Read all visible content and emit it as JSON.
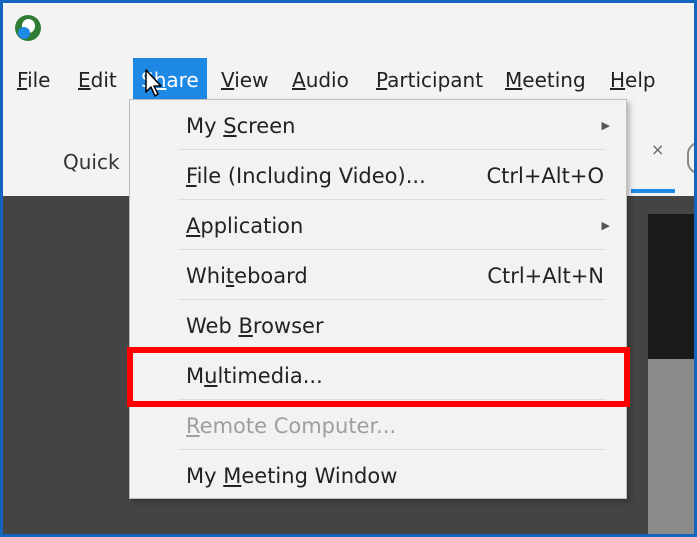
{
  "menubar": {
    "items": [
      {
        "label": "File",
        "u": "F",
        "rest": "ile"
      },
      {
        "label": "Edit",
        "u": "E",
        "rest": "dit"
      },
      {
        "label": "Share",
        "pre": "S",
        "u": "h",
        "rest": "are"
      },
      {
        "label": "View",
        "u": "V",
        "rest": "iew"
      },
      {
        "label": "Audio",
        "u": "A",
        "rest": "udio"
      },
      {
        "label": "Participant",
        "u": "P",
        "rest": "articipant"
      },
      {
        "label": "Meeting",
        "u": "M",
        "rest": "eeting"
      },
      {
        "label": "Help",
        "u": "H",
        "rest": "elp"
      }
    ]
  },
  "toolbar": {
    "quick_label": "Quick",
    "close_glyph": "×"
  },
  "share_menu": {
    "items": [
      {
        "pre": "My ",
        "u": "S",
        "rest": "creen",
        "shortcut": "",
        "submenu": true,
        "disabled": false
      },
      {
        "pre": "",
        "u": "F",
        "rest": "ile (Including Video)...",
        "shortcut": "Ctrl+Alt+O",
        "submenu": false,
        "disabled": false
      },
      {
        "pre": "",
        "u": "A",
        "rest": "pplication",
        "shortcut": "",
        "submenu": true,
        "disabled": false
      },
      {
        "pre": "Whi",
        "u": "t",
        "rest": "eboard",
        "shortcut": "Ctrl+Alt+N",
        "submenu": false,
        "disabled": false
      },
      {
        "pre": "Web ",
        "u": "B",
        "rest": "rowser",
        "shortcut": "",
        "submenu": false,
        "disabled": false
      },
      {
        "pre": "M",
        "u": "u",
        "rest": "ltimedia...",
        "shortcut": "",
        "submenu": false,
        "disabled": false,
        "highlighted": true
      },
      {
        "pre": "",
        "u": "R",
        "rest": "emote Computer...",
        "shortcut": "",
        "submenu": false,
        "disabled": true
      },
      {
        "pre": "My ",
        "u": "M",
        "rest": "eeting Window",
        "shortcut": "",
        "submenu": false,
        "disabled": false
      }
    ]
  },
  "colors": {
    "accent": "#1e88e5",
    "frame_border": "#1565c0",
    "highlight_box": "#ff0000"
  },
  "icons": {
    "app_logo": "app-logo-icon",
    "submenu_arrow": "chevron-right-icon",
    "cursor": "mouse-pointer-icon"
  }
}
